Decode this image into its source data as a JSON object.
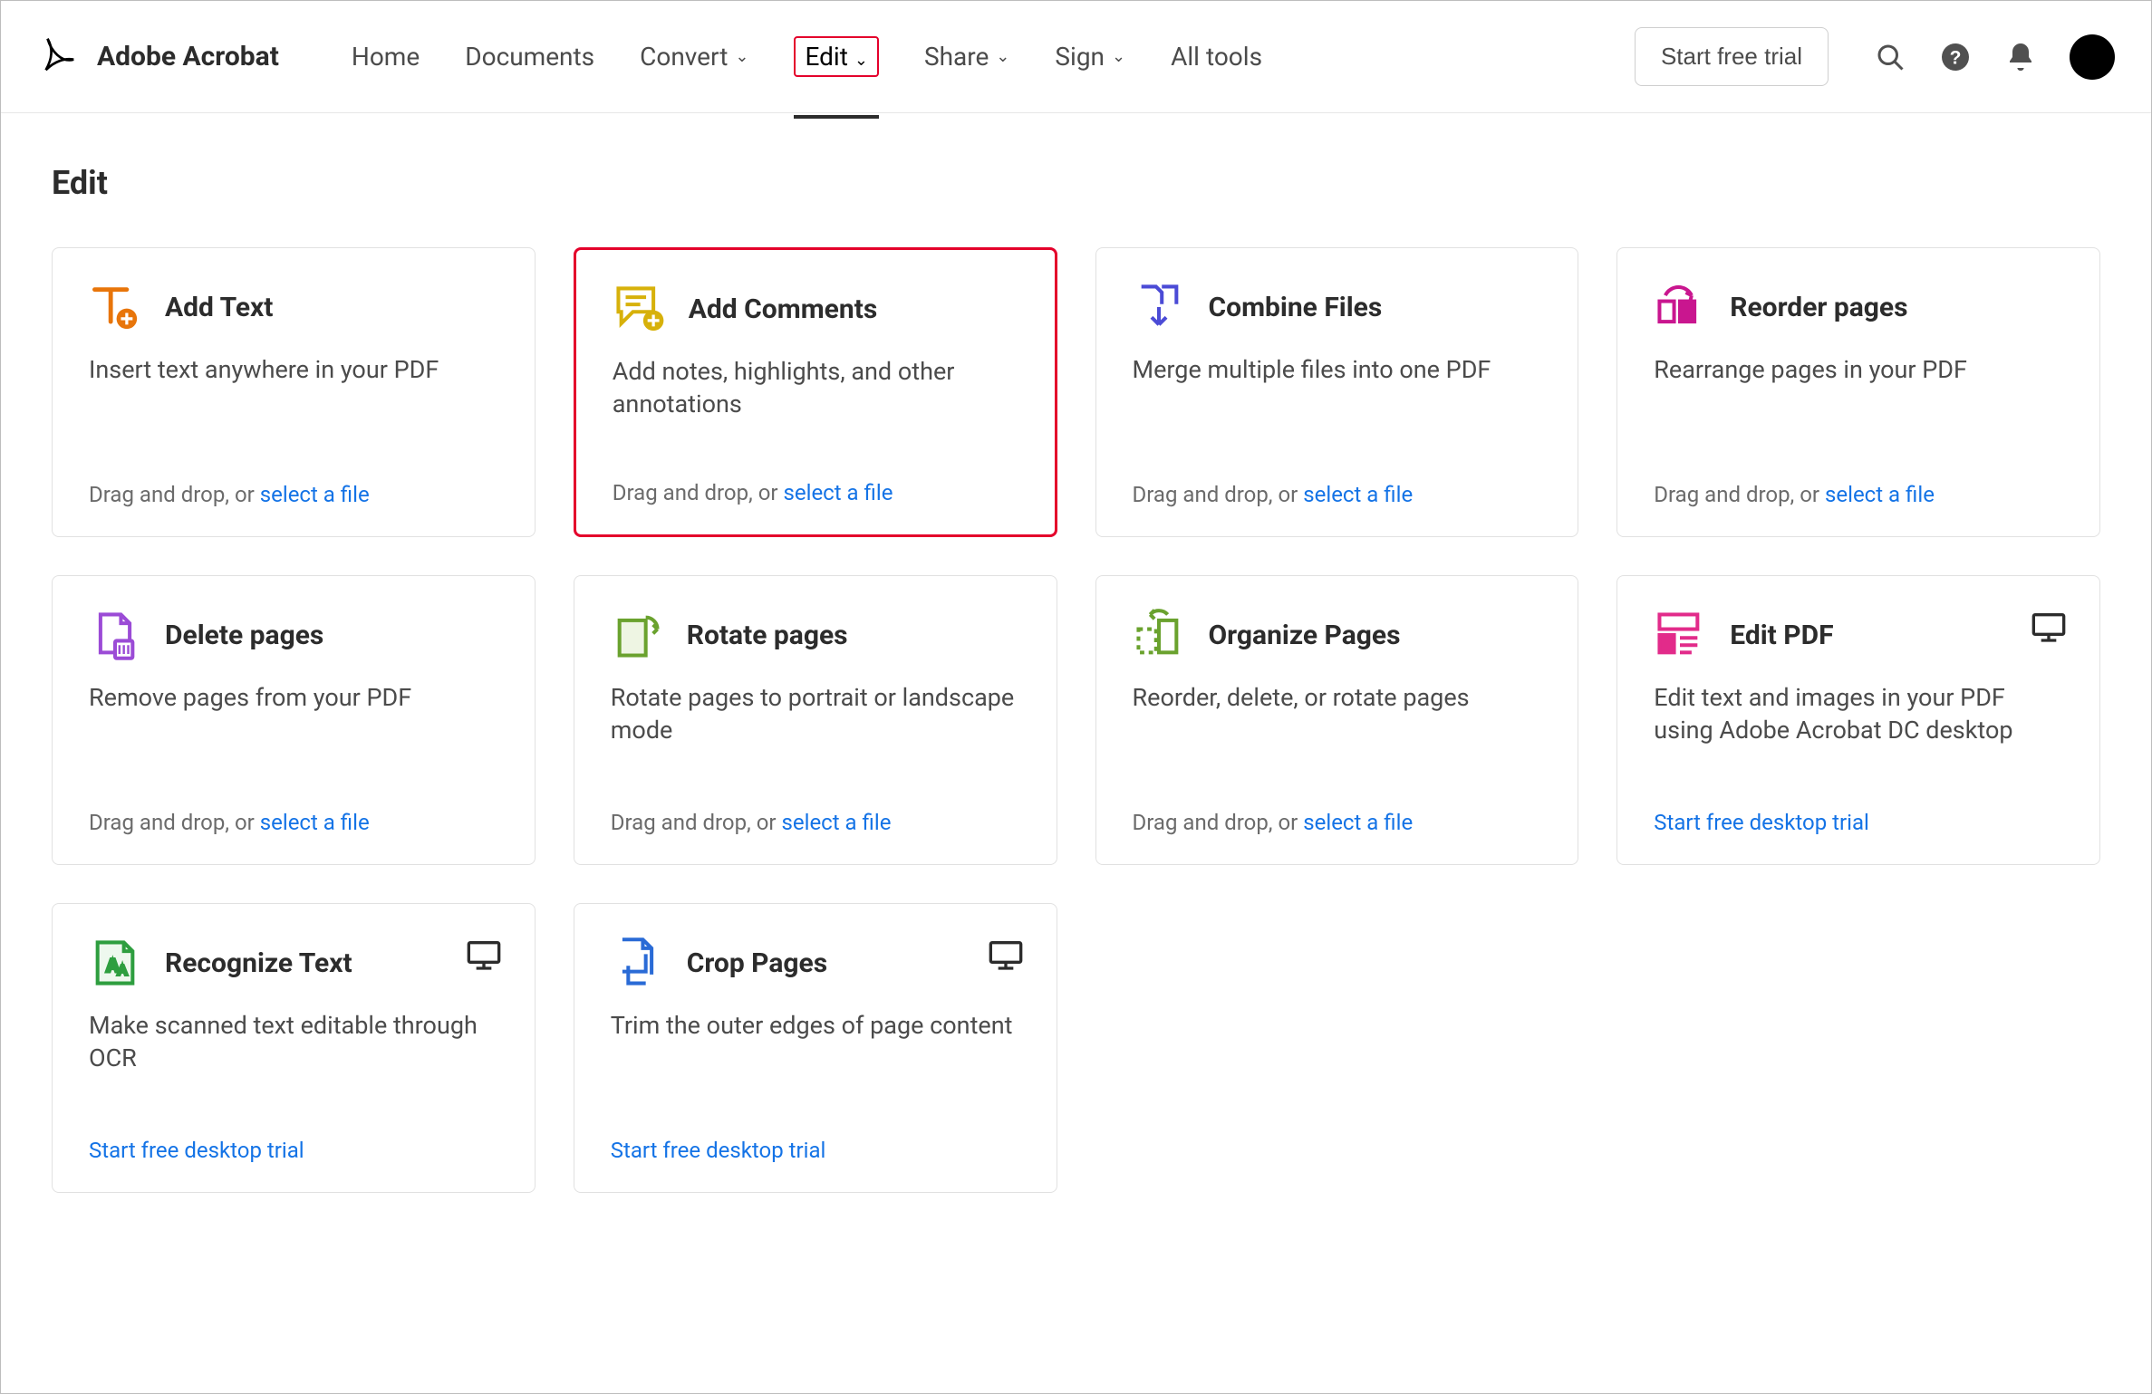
{
  "brand": {
    "name": "Adobe Acrobat"
  },
  "nav": {
    "items": [
      {
        "label": "Home",
        "dropdown": false
      },
      {
        "label": "Documents",
        "dropdown": false
      },
      {
        "label": "Convert",
        "dropdown": true
      },
      {
        "label": "Edit",
        "dropdown": true,
        "active": true,
        "boxed_red": true
      },
      {
        "label": "Share",
        "dropdown": true
      },
      {
        "label": "Sign",
        "dropdown": true
      },
      {
        "label": "All tools",
        "dropdown": false
      }
    ]
  },
  "header": {
    "trial_button": "Start free trial"
  },
  "page": {
    "title": "Edit",
    "drag_prefix": "Drag and drop, or ",
    "select_link": "select a file",
    "desktop_trial": "Start free desktop trial"
  },
  "cards": [
    {
      "id": "add-text",
      "title": "Add Text",
      "desc": "Insert text anywhere in your PDF",
      "action": "drop"
    },
    {
      "id": "add-comments",
      "title": "Add Comments",
      "desc": "Add notes, highlights, and other annotations",
      "action": "drop",
      "highlight_red": true
    },
    {
      "id": "combine-files",
      "title": "Combine Files",
      "desc": "Merge multiple files into one PDF",
      "action": "drop"
    },
    {
      "id": "reorder-pages",
      "title": "Reorder pages",
      "desc": "Rearrange pages in your PDF",
      "action": "drop"
    },
    {
      "id": "delete-pages",
      "title": "Delete pages",
      "desc": "Remove pages from your PDF",
      "action": "drop"
    },
    {
      "id": "rotate-pages",
      "title": "Rotate pages",
      "desc": "Rotate pages to portrait or landscape mode",
      "action": "drop"
    },
    {
      "id": "organize-pages",
      "title": "Organize Pages",
      "desc": "Reorder, delete, or rotate pages",
      "action": "drop"
    },
    {
      "id": "edit-pdf",
      "title": "Edit PDF",
      "desc": "Edit text and images in your PDF using Adobe Acrobat DC desktop",
      "action": "desktop",
      "desktop_badge": true
    },
    {
      "id": "recognize-text",
      "title": "Recognize Text",
      "desc": "Make scanned text editable through OCR",
      "action": "desktop",
      "desktop_badge": true
    },
    {
      "id": "crop-pages",
      "title": "Crop Pages",
      "desc": "Trim the outer edges of page content",
      "action": "desktop",
      "desktop_badge": true
    }
  ]
}
